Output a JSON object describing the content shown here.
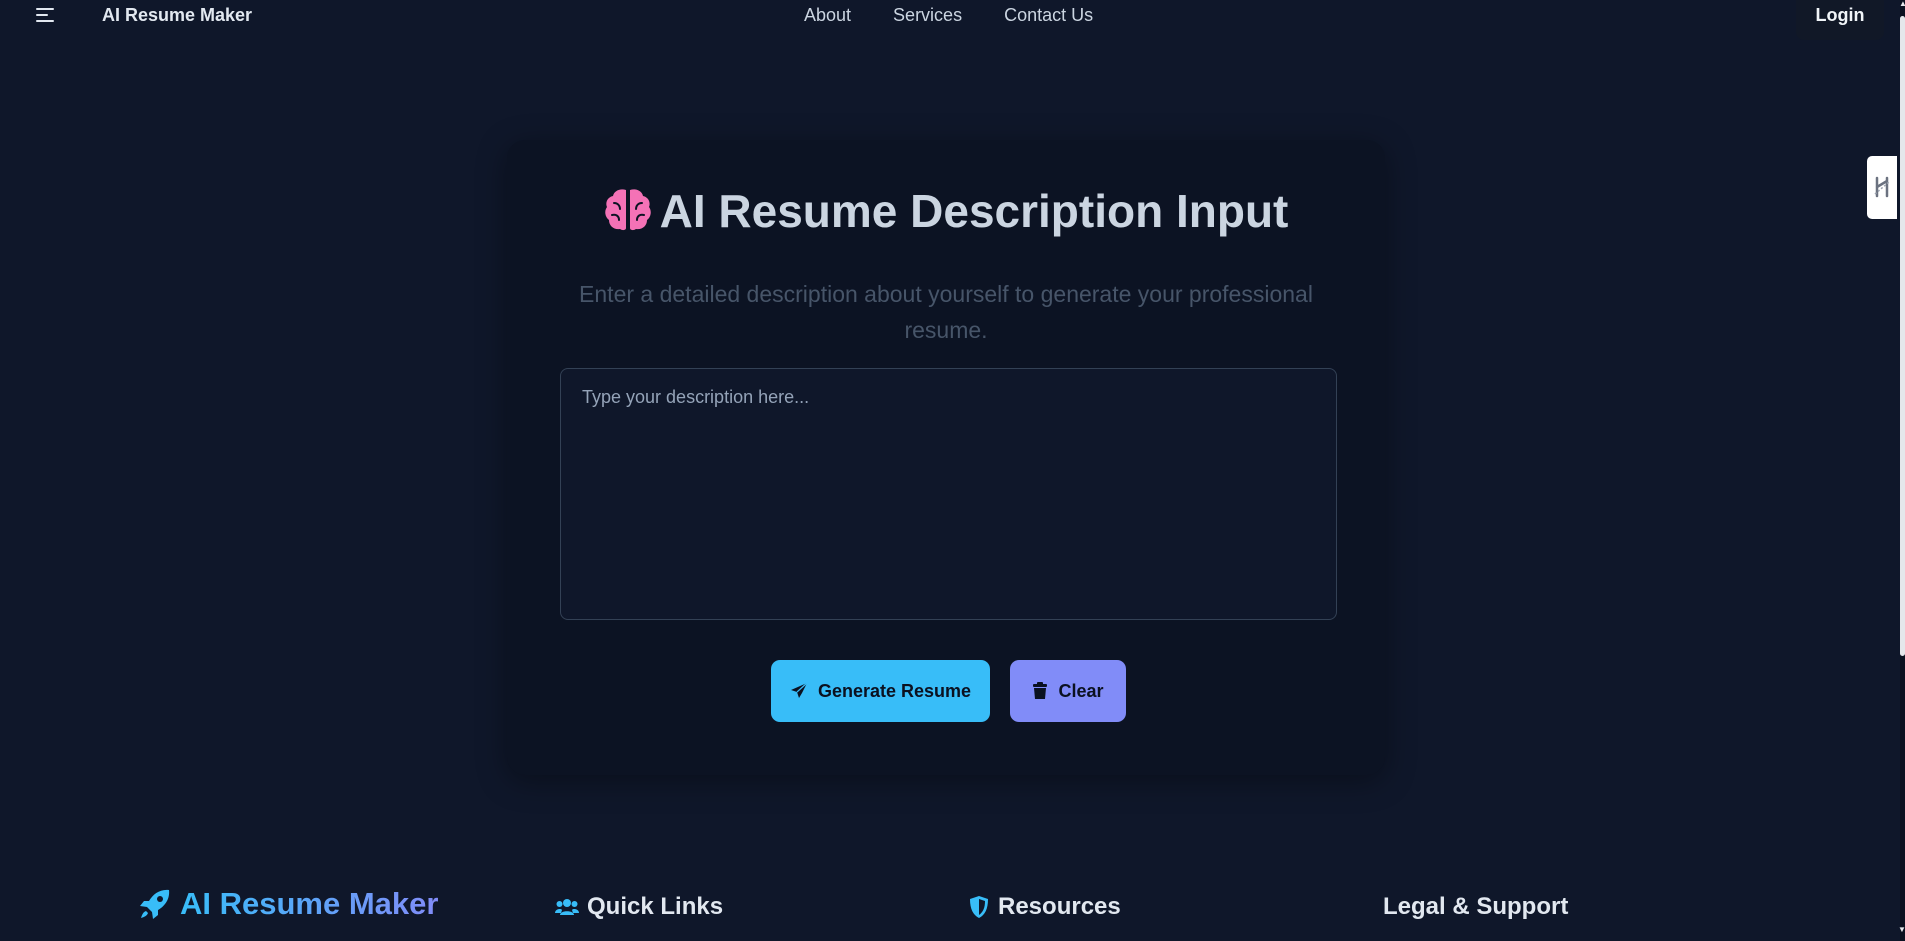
{
  "navbar": {
    "brand": "AI Resume Maker",
    "links": [
      "About",
      "Services",
      "Contact Us"
    ],
    "login_label": "Login"
  },
  "main": {
    "title": "AI Resume Description Input",
    "subtitle": "Enter a detailed description about yourself to generate your professional resume.",
    "description_placeholder": "Type your description here...",
    "description_value": "",
    "generate_label": "Generate Resume",
    "clear_label": "Clear"
  },
  "footer": {
    "brand": "AI Resume Maker",
    "quick_links_title": "Quick Links",
    "resources_title": "Resources",
    "legal_title": "Legal & Support"
  },
  "colors": {
    "background": "#0f172a",
    "card": "#0c1323",
    "accent_blue": "#38bdf8",
    "accent_indigo": "#818cf8",
    "brain_pink": "#f472b6"
  },
  "icons": {
    "menu": "hamburger-icon",
    "title": "brain-icon",
    "generate": "paper-plane-icon",
    "clear": "trash-icon",
    "footer_brand": "rocket-icon",
    "quick_links": "users-icon",
    "resources": "shield-icon"
  }
}
